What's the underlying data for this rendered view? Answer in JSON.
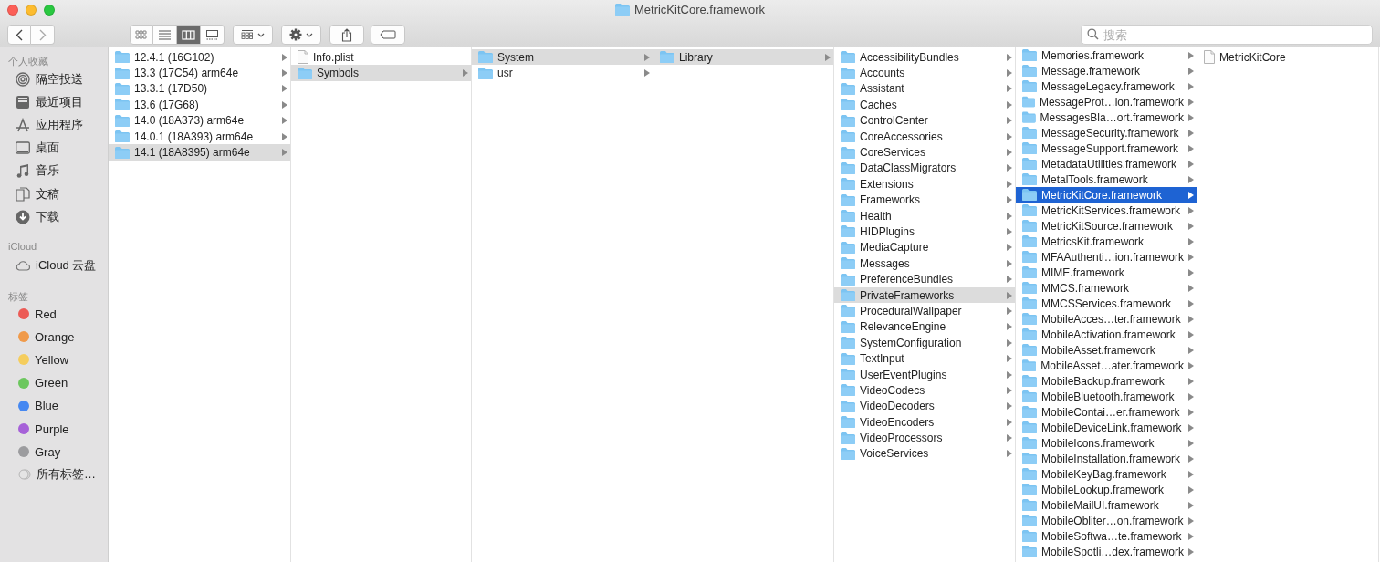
{
  "window": {
    "title": "MetricKitCore.framework"
  },
  "toolbar": {
    "view_modes": [
      {
        "kind": "icons",
        "selected": false
      },
      {
        "kind": "list",
        "selected": false
      },
      {
        "kind": "columns",
        "selected": true
      },
      {
        "kind": "gallery",
        "selected": false
      }
    ],
    "search": {
      "placeholder": "搜索"
    }
  },
  "sidebar": {
    "sections": [
      {
        "title": "个人收藏",
        "items": [
          {
            "kind": "airdrop",
            "label": "隔空投送"
          },
          {
            "kind": "recents",
            "label": "最近项目"
          },
          {
            "kind": "applications",
            "label": "应用程序"
          },
          {
            "kind": "desktop",
            "label": "桌面"
          },
          {
            "kind": "music",
            "label": "音乐"
          },
          {
            "kind": "documents",
            "label": "文稿"
          },
          {
            "kind": "downloads",
            "label": "下载"
          }
        ]
      },
      {
        "title": "iCloud",
        "items": [
          {
            "kind": "cloud",
            "label": "iCloud 云盘"
          }
        ]
      },
      {
        "title": "标签",
        "items": [
          {
            "kind": "tag",
            "label": "Red",
            "color": "#ec5b56"
          },
          {
            "kind": "tag",
            "label": "Orange",
            "color": "#f09a4a"
          },
          {
            "kind": "tag",
            "label": "Yellow",
            "color": "#f5cd5d"
          },
          {
            "kind": "tag",
            "label": "Green",
            "color": "#6cc75e"
          },
          {
            "kind": "tag",
            "label": "Blue",
            "color": "#4688f1"
          },
          {
            "kind": "tag",
            "label": "Purple",
            "color": "#a661d8"
          },
          {
            "kind": "tag",
            "label": "Gray",
            "color": "#9c9c9f"
          },
          {
            "kind": "all-tags",
            "label": "所有标签…"
          }
        ]
      }
    ]
  },
  "columns": [
    {
      "focused": false,
      "items": [
        {
          "kind": "folder",
          "name": "12.4.1 (16G102)",
          "selected": false
        },
        {
          "kind": "folder",
          "name": "13.3 (17C54) arm64e",
          "selected": false
        },
        {
          "kind": "folder",
          "name": "13.3.1 (17D50)",
          "selected": false
        },
        {
          "kind": "folder",
          "name": "13.6 (17G68)",
          "selected": false
        },
        {
          "kind": "folder",
          "name": "14.0 (18A373) arm64e",
          "selected": false
        },
        {
          "kind": "folder",
          "name": "14.0.1 (18A393) arm64e",
          "selected": false
        },
        {
          "kind": "folder",
          "name": "14.1 (18A8395) arm64e",
          "selected": true
        }
      ]
    },
    {
      "focused": false,
      "items": [
        {
          "kind": "file",
          "name": "Info.plist",
          "selected": false
        },
        {
          "kind": "folder",
          "name": "Symbols",
          "selected": true
        }
      ]
    },
    {
      "focused": false,
      "items": [
        {
          "kind": "folder",
          "name": "System",
          "selected": true
        },
        {
          "kind": "folder",
          "name": "usr",
          "selected": false
        }
      ]
    },
    {
      "focused": false,
      "items": [
        {
          "kind": "folder",
          "name": "Library",
          "selected": true
        }
      ]
    },
    {
      "focused": false,
      "items": [
        {
          "kind": "folder",
          "name": "AccessibilityBundles",
          "selected": false
        },
        {
          "kind": "folder",
          "name": "Accounts",
          "selected": false
        },
        {
          "kind": "folder",
          "name": "Assistant",
          "selected": false
        },
        {
          "kind": "folder",
          "name": "Caches",
          "selected": false
        },
        {
          "kind": "folder",
          "name": "ControlCenter",
          "selected": false
        },
        {
          "kind": "folder",
          "name": "CoreAccessories",
          "selected": false
        },
        {
          "kind": "folder",
          "name": "CoreServices",
          "selected": false
        },
        {
          "kind": "folder",
          "name": "DataClassMigrators",
          "selected": false
        },
        {
          "kind": "folder",
          "name": "Extensions",
          "selected": false
        },
        {
          "kind": "folder",
          "name": "Frameworks",
          "selected": false
        },
        {
          "kind": "folder",
          "name": "Health",
          "selected": false
        },
        {
          "kind": "folder",
          "name": "HIDPlugins",
          "selected": false
        },
        {
          "kind": "folder",
          "name": "MediaCapture",
          "selected": false
        },
        {
          "kind": "folder",
          "name": "Messages",
          "selected": false
        },
        {
          "kind": "folder",
          "name": "PreferenceBundles",
          "selected": false
        },
        {
          "kind": "folder",
          "name": "PrivateFrameworks",
          "selected": true
        },
        {
          "kind": "folder",
          "name": "ProceduralWallpaper",
          "selected": false
        },
        {
          "kind": "folder",
          "name": "RelevanceEngine",
          "selected": false
        },
        {
          "kind": "folder",
          "name": "SystemConfiguration",
          "selected": false
        },
        {
          "kind": "folder",
          "name": "TextInput",
          "selected": false
        },
        {
          "kind": "folder",
          "name": "UserEventPlugins",
          "selected": false
        },
        {
          "kind": "folder",
          "name": "VideoCodecs",
          "selected": false
        },
        {
          "kind": "folder",
          "name": "VideoDecoders",
          "selected": false
        },
        {
          "kind": "folder",
          "name": "VideoEncoders",
          "selected": false
        },
        {
          "kind": "folder",
          "name": "VideoProcessors",
          "selected": false
        },
        {
          "kind": "folder",
          "name": "VoiceServices",
          "selected": false
        }
      ]
    },
    {
      "focused": true,
      "items": [
        {
          "kind": "folder",
          "name": "Memories.framework",
          "selected": false
        },
        {
          "kind": "folder",
          "name": "Message.framework",
          "selected": false
        },
        {
          "kind": "folder",
          "name": "MessageLegacy.framework",
          "selected": false
        },
        {
          "kind": "folder",
          "name": "MessageProt…ion.framework",
          "selected": false
        },
        {
          "kind": "folder",
          "name": "MessagesBla…ort.framework",
          "selected": false
        },
        {
          "kind": "folder",
          "name": "MessageSecurity.framework",
          "selected": false
        },
        {
          "kind": "folder",
          "name": "MessageSupport.framework",
          "selected": false
        },
        {
          "kind": "folder",
          "name": "MetadataUtilities.framework",
          "selected": false
        },
        {
          "kind": "folder",
          "name": "MetalTools.framework",
          "selected": false
        },
        {
          "kind": "folder",
          "name": "MetricKitCore.framework",
          "selected": true
        },
        {
          "kind": "folder",
          "name": "MetricKitServices.framework",
          "selected": false
        },
        {
          "kind": "folder",
          "name": "MetricKitSource.framework",
          "selected": false
        },
        {
          "kind": "folder",
          "name": "MetricsKit.framework",
          "selected": false
        },
        {
          "kind": "folder",
          "name": "MFAAuthenti…ion.framework",
          "selected": false
        },
        {
          "kind": "folder",
          "name": "MIME.framework",
          "selected": false
        },
        {
          "kind": "folder",
          "name": "MMCS.framework",
          "selected": false
        },
        {
          "kind": "folder",
          "name": "MMCSServices.framework",
          "selected": false
        },
        {
          "kind": "folder",
          "name": "MobileAcces…ter.framework",
          "selected": false
        },
        {
          "kind": "folder",
          "name": "MobileActivation.framework",
          "selected": false
        },
        {
          "kind": "folder",
          "name": "MobileAsset.framework",
          "selected": false
        },
        {
          "kind": "folder",
          "name": "MobileAsset…ater.framework",
          "selected": false
        },
        {
          "kind": "folder",
          "name": "MobileBackup.framework",
          "selected": false
        },
        {
          "kind": "folder",
          "name": "MobileBluetooth.framework",
          "selected": false
        },
        {
          "kind": "folder",
          "name": "MobileContai…er.framework",
          "selected": false
        },
        {
          "kind": "folder",
          "name": "MobileDeviceLink.framework",
          "selected": false
        },
        {
          "kind": "folder",
          "name": "MobileIcons.framework",
          "selected": false
        },
        {
          "kind": "folder",
          "name": "MobileInstallation.framework",
          "selected": false
        },
        {
          "kind": "folder",
          "name": "MobileKeyBag.framework",
          "selected": false
        },
        {
          "kind": "folder",
          "name": "MobileLookup.framework",
          "selected": false
        },
        {
          "kind": "folder",
          "name": "MobileMailUI.framework",
          "selected": false
        },
        {
          "kind": "folder",
          "name": "MobileObliter…on.framework",
          "selected": false
        },
        {
          "kind": "folder",
          "name": "MobileSoftwa…te.framework",
          "selected": false
        },
        {
          "kind": "folder",
          "name": "MobileSpotli…dex.framework",
          "selected": false
        }
      ]
    },
    {
      "items": [
        {
          "kind": "file",
          "name": "MetricKitCore",
          "selected": false
        }
      ]
    }
  ]
}
